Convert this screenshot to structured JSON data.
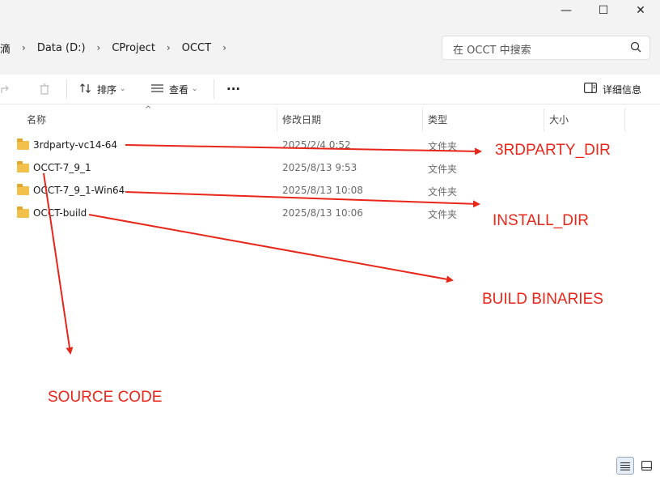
{
  "window": {
    "minimize_glyph": "—",
    "maximize_glyph": "☐",
    "close_glyph": "✕"
  },
  "address": {
    "crumbs": [
      "滴",
      "Data (D:)",
      "CProject",
      "OCCT"
    ],
    "separator": "›"
  },
  "search": {
    "placeholder": "在 OCCT 中搜索"
  },
  "toolbar": {
    "sort_label": "排序",
    "view_label": "查看",
    "more_label": "···",
    "details_label": "详细信息"
  },
  "columns": {
    "name": "名称",
    "date": "修改日期",
    "type": "类型",
    "size": "大小"
  },
  "rows": [
    {
      "name": "3rdparty-vc14-64",
      "date": "2025/2/4 0:52",
      "type": "文件夹"
    },
    {
      "name": "OCCT-7_9_1",
      "date": "2025/8/13 9:53",
      "type": "文件夹"
    },
    {
      "name": "OCCT-7_9_1-Win64",
      "date": "2025/8/13 10:08",
      "type": "文件夹"
    },
    {
      "name": "OCCT-build",
      "date": "2025/8/13 10:06",
      "type": "文件夹"
    }
  ],
  "annotations": {
    "thirdparty": "3RDPARTY_DIR",
    "install": "INSTALL_DIR",
    "build": "BUILD BINARIES",
    "source": "SOURCE CODE",
    "color": "#e8261a"
  }
}
